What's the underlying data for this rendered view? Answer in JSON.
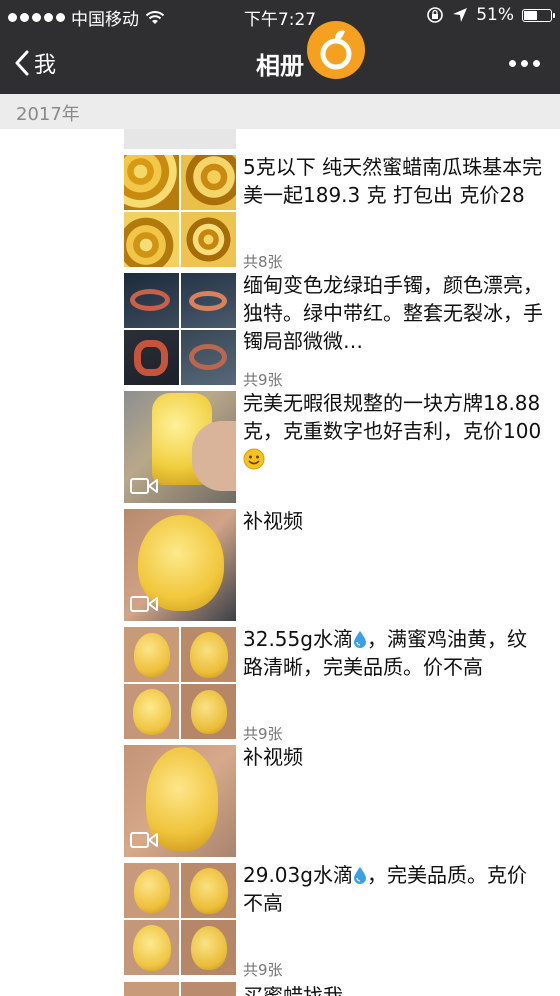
{
  "status": {
    "carrier": "中国移动",
    "time": "下午7:27",
    "battery": "51%",
    "battery_level": 0.51
  },
  "nav": {
    "back_label": "我",
    "title": "相册"
  },
  "year": "2017年",
  "posts": [
    {
      "text": "5克以下 纯天然蜜蜡南瓜珠基本完美一起189.3 克 打包出 克价28",
      "count": "共8张"
    },
    {
      "text": "缅甸变色龙绿珀手镯，颜色漂亮，独特。绿中带红。整套无裂冰，手镯局部微微…",
      "count": "共9张"
    },
    {
      "text": "完美无暇很规整的一块方牌18.88克，克重数字也好吉利，克价100"
    },
    {
      "text": "补视频"
    },
    {
      "text_before": "32.55g水滴",
      "text_after": "，满蜜鸡油黄，纹路清晰，完美品质。价不高",
      "count": "共9张"
    },
    {
      "text": "补视频"
    },
    {
      "text_before": "29.03g水滴",
      "text_after": "，完美品质。克价不高",
      "count": "共9张"
    },
    {
      "text": "买蜜蜡找我"
    }
  ]
}
